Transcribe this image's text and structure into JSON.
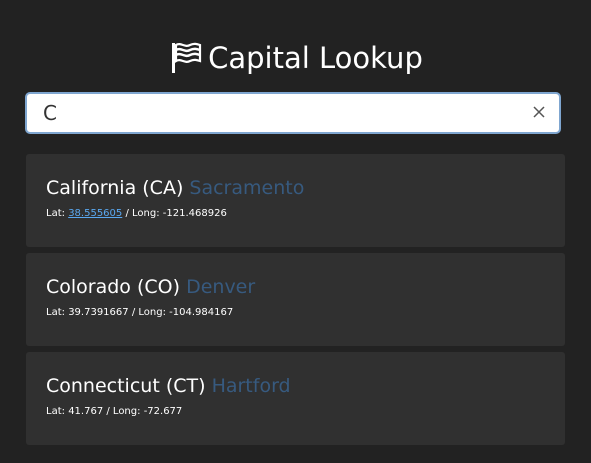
{
  "header": {
    "title": "Capital Lookup",
    "icon": "flag-icon"
  },
  "search": {
    "value": "C",
    "clear_icon": "close-icon"
  },
  "results": [
    {
      "state": "California (CA)",
      "capital": "Sacramento",
      "lat_label": "Lat:",
      "lat": "38.555605",
      "long_label": "/ Long:",
      "long": "-121.468926"
    },
    {
      "state": "Colorado (CO)",
      "capital": "Denver",
      "lat_label": "Lat:",
      "lat": "39.7391667",
      "long_label": "/ Long:",
      "long": "-104.984167"
    },
    {
      "state": "Connecticut (CT)",
      "capital": "Hartford",
      "lat_label": "Lat:",
      "lat": "41.767",
      "long_label": "/ Long:",
      "long": "-72.677"
    }
  ],
  "colors": {
    "background": "#222222",
    "card": "#303030",
    "capital_text": "#375a7f",
    "link": "#5aa8f0",
    "input_border": "#7fa6d0"
  }
}
